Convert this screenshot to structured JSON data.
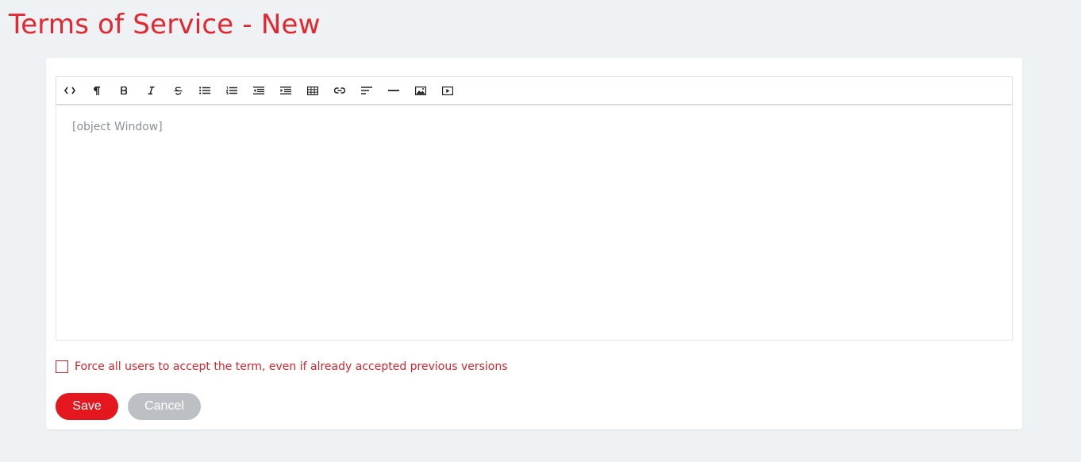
{
  "page": {
    "title": "Terms of Service - New"
  },
  "editor": {
    "toolbar": [
      {
        "name": "code-view-icon",
        "title": "HTML"
      },
      {
        "name": "paragraph-icon",
        "title": "Formatting"
      },
      {
        "name": "bold-icon",
        "title": "Bold"
      },
      {
        "name": "italic-icon",
        "title": "Italic"
      },
      {
        "name": "strikethrough-icon",
        "title": "Deleted"
      },
      {
        "name": "bullet-list-icon",
        "title": "Unordered List"
      },
      {
        "name": "numbered-list-icon",
        "title": "Ordered List"
      },
      {
        "name": "outdent-icon",
        "title": "Outdent"
      },
      {
        "name": "indent-icon",
        "title": "Indent"
      },
      {
        "name": "table-icon",
        "title": "Table"
      },
      {
        "name": "link-icon",
        "title": "Link"
      },
      {
        "name": "align-icon",
        "title": "Alignment"
      },
      {
        "name": "horizontal-rule-icon",
        "title": "Insert Horizontal Rule"
      },
      {
        "name": "image-icon",
        "title": "Image"
      },
      {
        "name": "video-icon",
        "title": "Video"
      }
    ],
    "content": "[object Window]"
  },
  "force_accept": {
    "label": "Force all users to accept the term, even if already accepted previous versions",
    "checked": false
  },
  "actions": {
    "save_label": "Save",
    "cancel_label": "Cancel"
  },
  "colors": {
    "accent": "#e4262f",
    "save": "#e4161e",
    "cancel": "#bcc0c4",
    "background": "#eff2f5"
  }
}
